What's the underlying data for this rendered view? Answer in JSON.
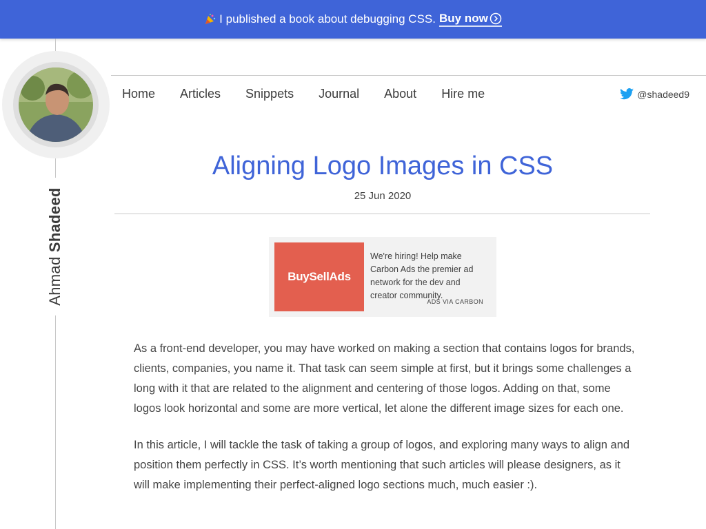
{
  "banner": {
    "message": "I published a book about debugging CSS.",
    "cta": "Buy now",
    "icon": "party-popper-icon",
    "background": "#3f64d8"
  },
  "author": {
    "first_name": "Ahmad",
    "last_name": "Shadeed"
  },
  "nav": {
    "items": [
      "Home",
      "Articles",
      "Snippets",
      "Journal",
      "About",
      "Hire me"
    ],
    "twitter_handle": "@shadeed9"
  },
  "article": {
    "title": "Aligning Logo Images in CSS",
    "date": "25 Jun 2020",
    "paragraphs": [
      "As a front-end developer, you may have worked on making a section that contains logos for brands, clients, companies, you name it. That task can seem simple at first, but it brings some challenges a long with it that are related to the alignment and centering of those logos. Adding on that, some logos look horizontal and some are more vertical, let alone the different image sizes for each one.",
      "In this article, I will tackle the task of taking a group of logos, and exploring many ways to align and position them perfectly in CSS. It’s worth mentioning that such articles will please designers, as it will make implementing their perfect-aligned logo sections much, much easier :)."
    ]
  },
  "ad": {
    "brand": "BuySellAds",
    "text": "We're hiring! Help make Carbon Ads the premier ad network for the dev and creator community.",
    "via": "ADS VIA CARBON",
    "brand_color": "#e35f4f"
  },
  "colors": {
    "accent": "#3f64d8",
    "twitter": "#1da1f2"
  }
}
